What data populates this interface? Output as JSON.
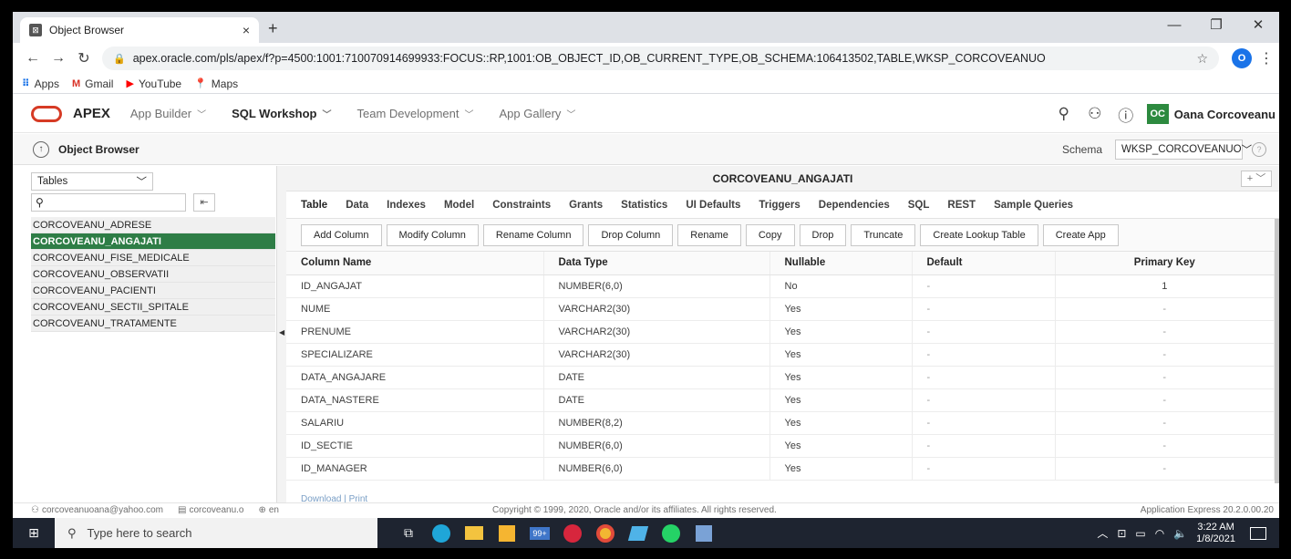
{
  "browser": {
    "tab_title": "Object Browser",
    "tab_close": "×",
    "new_tab": "+",
    "url": "apex.oracle.com/pls/apex/f?p=4500:1001:710070914699933:FOCUS::RP,1001:OB_OBJECT_ID,OB_CURRENT_TYPE,OB_SCHEMA:106413502,TABLE,WKSP_CORCOVEANUO",
    "profile_initial": "O",
    "bookmarks": [
      {
        "label": "Apps",
        "icon": "apps-grid-icon"
      },
      {
        "label": "Gmail",
        "icon": "gmail-icon"
      },
      {
        "label": "YouTube",
        "icon": "youtube-icon"
      },
      {
        "label": "Maps",
        "icon": "maps-icon"
      }
    ]
  },
  "apex": {
    "brand": "APEX",
    "menus": [
      "App Builder",
      "SQL Workshop",
      "Team Development",
      "App Gallery"
    ],
    "user_initials": "OC",
    "user_name": "Oana Corcoveanu"
  },
  "page": {
    "title": "Object Browser",
    "schema_label": "Schema",
    "schema_value": "WKSP_CORCOVEANUO"
  },
  "left": {
    "object_type": "Tables",
    "search_placeholder": "",
    "objects": [
      "CORCOVEANU_ADRESE",
      "CORCOVEANU_ANGAJATI",
      "CORCOVEANU_FISE_MEDICALE",
      "CORCOVEANU_OBSERVATII",
      "CORCOVEANU_PACIENTI",
      "CORCOVEANU_SECTII_SPITALE",
      "CORCOVEANU_TRATAMENTE"
    ],
    "selected": "CORCOVEANU_ANGAJATI"
  },
  "right": {
    "object_name": "CORCOVEANU_ANGAJATI",
    "plus_label": "+ ﹀",
    "tabs": [
      "Table",
      "Data",
      "Indexes",
      "Model",
      "Constraints",
      "Grants",
      "Statistics",
      "UI Defaults",
      "Triggers",
      "Dependencies",
      "SQL",
      "REST",
      "Sample Queries"
    ],
    "actions": [
      "Add Column",
      "Modify Column",
      "Rename Column",
      "Drop Column",
      "Rename",
      "Copy",
      "Drop",
      "Truncate",
      "Create Lookup Table",
      "Create App"
    ],
    "columns": [
      "Column Name",
      "Data Type",
      "Nullable",
      "Default",
      "Primary Key"
    ],
    "rows": [
      [
        "ID_ANGAJAT",
        "NUMBER(6,0)",
        "No",
        "-",
        "1"
      ],
      [
        "NUME",
        "VARCHAR2(30)",
        "Yes",
        "-",
        "-"
      ],
      [
        "PRENUME",
        "VARCHAR2(30)",
        "Yes",
        "-",
        "-"
      ],
      [
        "SPECIALIZARE",
        "VARCHAR2(30)",
        "Yes",
        "-",
        "-"
      ],
      [
        "DATA_ANGAJARE",
        "DATE",
        "Yes",
        "-",
        "-"
      ],
      [
        "DATA_NASTERE",
        "DATE",
        "Yes",
        "-",
        "-"
      ],
      [
        "SALARIU",
        "NUMBER(8,2)",
        "Yes",
        "-",
        "-"
      ],
      [
        "ID_SECTIE",
        "NUMBER(6,0)",
        "Yes",
        "-",
        "-"
      ],
      [
        "ID_MANAGER",
        "NUMBER(6,0)",
        "Yes",
        "-",
        "-"
      ]
    ],
    "download_print": "Download | Print"
  },
  "footer": {
    "email": "corcoveanuoana@yahoo.com",
    "workspace": "corcoveanu.o",
    "language": "en",
    "copyright": "Copyright © 1999, 2020, Oracle and/or its affiliates. All rights reserved.",
    "version": "Application Express 20.2.0.00.20"
  },
  "taskbar": {
    "search_placeholder": "Type here to search",
    "badge": "99+",
    "time": "3:22 AM",
    "date": "1/8/2021"
  },
  "colors": {
    "apex_red": "#d63b25",
    "selected_green": "#2e7d46",
    "user_badge": "#2d8a3f"
  }
}
